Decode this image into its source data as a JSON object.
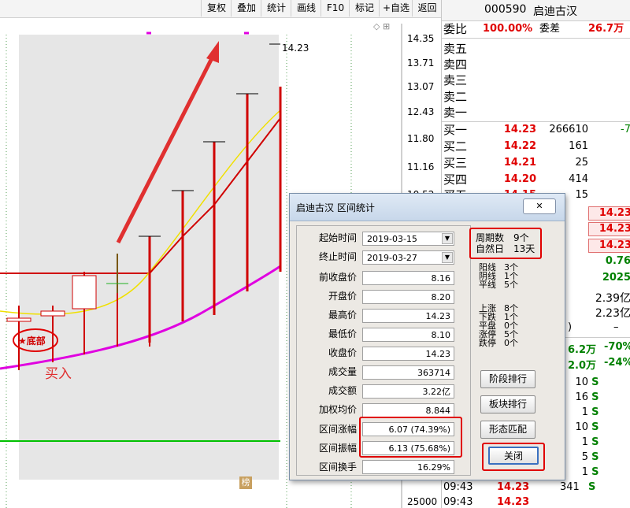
{
  "toolbar": {
    "items": [
      "复权",
      "叠加",
      "统计",
      "画线",
      "F10",
      "标记",
      "+自选",
      "返回"
    ],
    "corner_glyphs": "◇ ⊞"
  },
  "chart": {
    "price_ticks": [
      "14.35",
      "13.71",
      "13.07",
      "12.43",
      "11.80",
      "11.16",
      "10.52"
    ],
    "bottom_tick": "25000",
    "last_price_mark": "14.23",
    "bottom_badge_label": "榜",
    "annotation_bottom": "★底部",
    "annotation_buy": "买入"
  },
  "quote": {
    "code": "000590",
    "name": "启迪古汉",
    "wei_bi_label": "委比",
    "wei_bi_value": "100.00%",
    "wei_cha_label": "委差",
    "wei_cha_value": "26.7万",
    "sell_labels": [
      "卖五",
      "卖四",
      "卖三",
      "卖二",
      "卖一"
    ],
    "buy": [
      {
        "label": "买一",
        "price": "14.23",
        "vol": "266610",
        "chg": "-7"
      },
      {
        "label": "买二",
        "price": "14.22",
        "vol": "161",
        "chg": ""
      },
      {
        "label": "买三",
        "price": "14.21",
        "vol": "25",
        "chg": ""
      },
      {
        "label": "买四",
        "price": "14.20",
        "vol": "414",
        "chg": ""
      },
      {
        "label": "买五",
        "price": "14.15",
        "vol": "15",
        "chg": ""
      }
    ],
    "right_values": [
      "14.23",
      "14.23",
      "14.23",
      "0.76",
      "2025"
    ],
    "amounts": [
      "2.39亿",
      "2.23亿"
    ],
    "dash": "–",
    "paren": ")",
    "flow_rows": [
      {
        "a": "6.2万",
        "b": "-70%"
      },
      {
        "a": "2.0万",
        "b": "-24%"
      }
    ],
    "ticks": [
      {
        "v": "10",
        "s": "S"
      },
      {
        "v": "16",
        "s": "S"
      },
      {
        "v": "1",
        "s": "S"
      },
      {
        "v": "10",
        "s": "S"
      },
      {
        "v": "1",
        "s": "S"
      },
      {
        "v": "5",
        "s": "S"
      },
      {
        "v": "1",
        "s": "S"
      },
      {
        "v": "1",
        "s": "S"
      }
    ],
    "tape": [
      {
        "time": "09:43",
        "price": "14.23",
        "vol": "341",
        "s": "S"
      },
      {
        "time": "09:43",
        "price": "14.23",
        "vol": "",
        "s": ""
      }
    ]
  },
  "dialog": {
    "title": "启迪古汉 区间统计",
    "close_glyph": "✕",
    "fields": [
      {
        "label": "起始时间",
        "value": "2019-03-15",
        "combo": true
      },
      {
        "label": "终止时间",
        "value": "2019-03-27",
        "combo": true
      },
      {
        "label": "前收盘价",
        "value": "8.16"
      },
      {
        "label": "开盘价",
        "value": "8.20"
      },
      {
        "label": "最高价",
        "value": "14.23"
      },
      {
        "label": "最低价",
        "value": "8.10"
      },
      {
        "label": "收盘价",
        "value": "14.23"
      },
      {
        "label": "成交量",
        "value": "363714"
      },
      {
        "label": "成交额",
        "value": "3.22亿"
      },
      {
        "label": "加权均价",
        "value": "8.844"
      },
      {
        "label": "区间涨幅",
        "value": "6.07 (74.39%)"
      },
      {
        "label": "区间振幅",
        "value": "6.13 (75.68%)"
      },
      {
        "label": "区间换手",
        "value": "16.29%"
      }
    ],
    "period_label": "周期数",
    "period_value": "9个",
    "natural_label": "自然日",
    "natural_value": "13天",
    "stats": [
      {
        "label": "阳线",
        "value": "3个"
      },
      {
        "label": "阴线",
        "value": "1个"
      },
      {
        "label": "平线",
        "value": "5个"
      },
      {
        "label": "上涨",
        "value": "8个"
      },
      {
        "label": "下跌",
        "value": "1个"
      },
      {
        "label": "平盘",
        "value": "0个"
      },
      {
        "label": "涨停",
        "value": "5个"
      },
      {
        "label": "跌停",
        "value": "0个"
      }
    ],
    "buttons": [
      "阶段排行",
      "板块排行",
      "形态匹配",
      "关闭"
    ]
  },
  "colors": {
    "up": "#e00000",
    "down": "#008000",
    "ma_magenta": "#e000e0",
    "ma_yellow": "#f0f000",
    "highlight_box": "#e00000"
  }
}
